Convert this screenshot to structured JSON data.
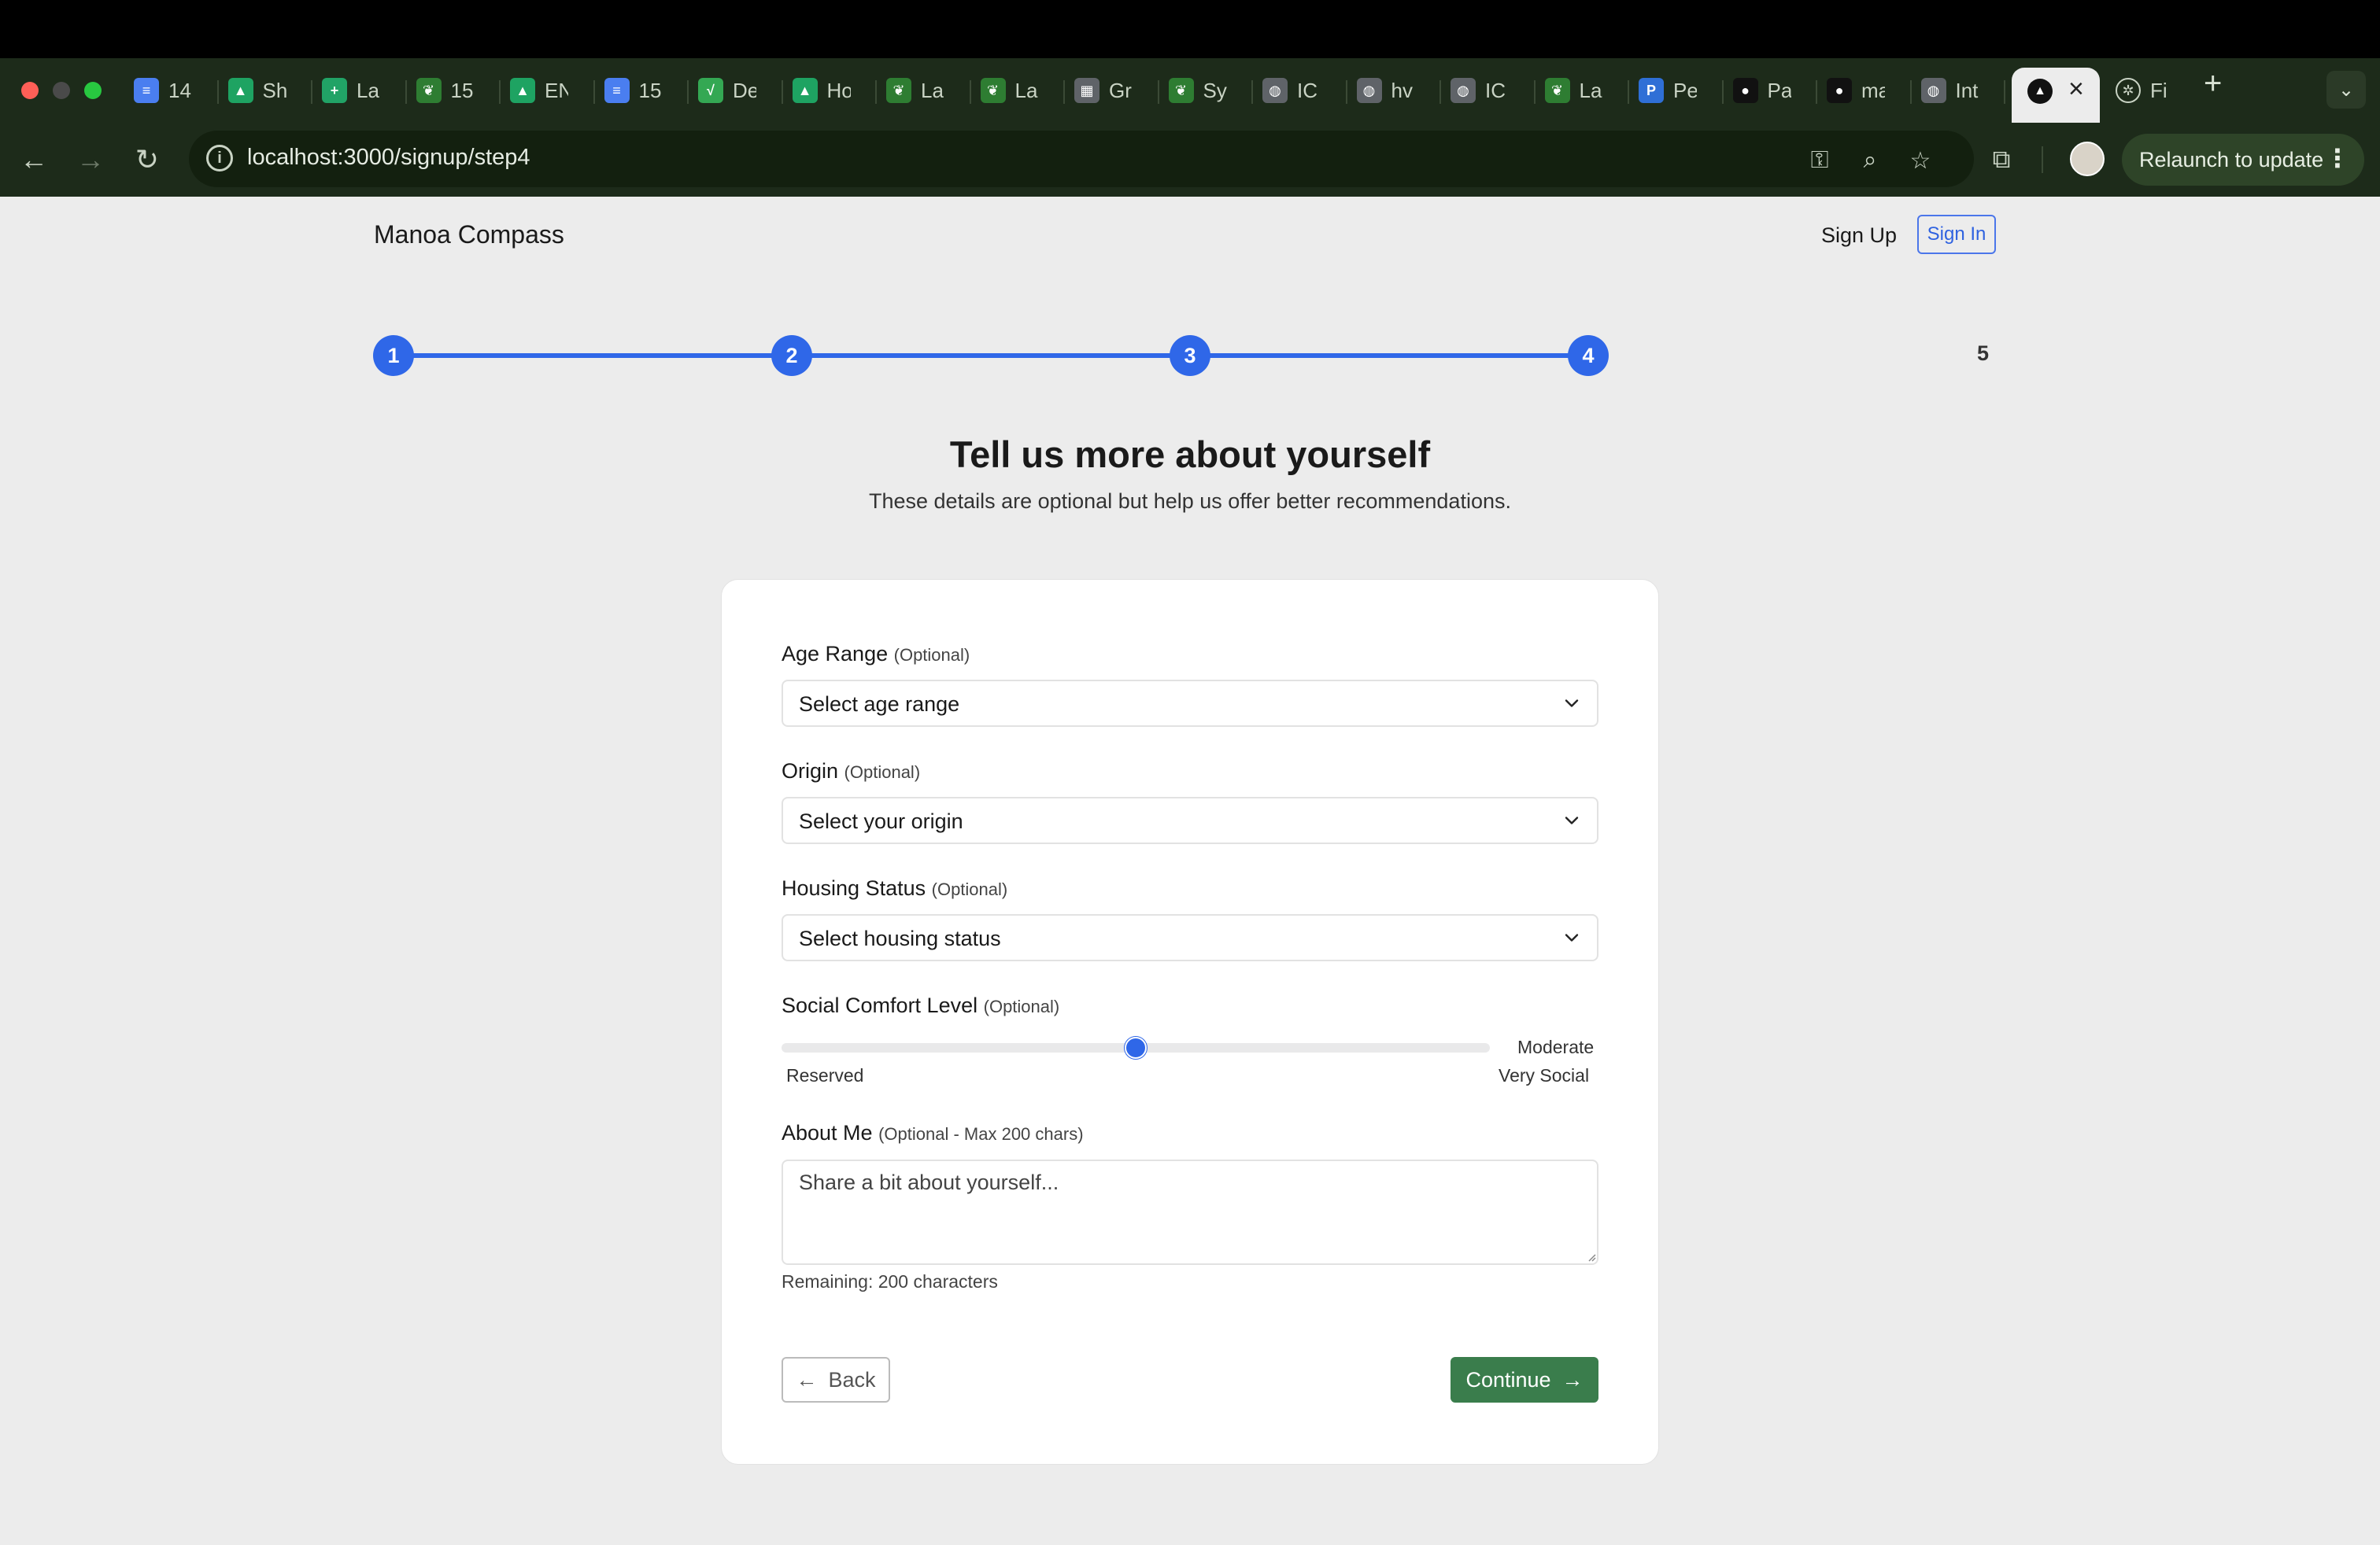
{
  "browser": {
    "tabs": [
      {
        "title": "14",
        "icon": "docs-icon",
        "color": "#4a7ef0",
        "glyph": "≡"
      },
      {
        "title": "Sh",
        "icon": "drive-icon",
        "color": "#1ea362",
        "glyph": "▲"
      },
      {
        "title": "La",
        "icon": "sheets-icon",
        "color": "#21a366",
        "glyph": "+"
      },
      {
        "title": "15",
        "icon": "leaf-icon",
        "color": "#2e7d32",
        "glyph": "❦"
      },
      {
        "title": "EN",
        "icon": "drive-icon",
        "color": "#1ea362",
        "glyph": "▲"
      },
      {
        "title": "15",
        "icon": "docs-icon",
        "color": "#4a7ef0",
        "glyph": "≡"
      },
      {
        "title": "De",
        "icon": "chart-icon",
        "color": "#34a853",
        "glyph": "√"
      },
      {
        "title": "Ho",
        "icon": "drive-icon",
        "color": "#1ea362",
        "glyph": "▲"
      },
      {
        "title": "La",
        "icon": "leaf-icon",
        "color": "#2e7d32",
        "glyph": "❦"
      },
      {
        "title": "La",
        "icon": "leaf-icon",
        "color": "#2e7d32",
        "glyph": "❦"
      },
      {
        "title": "Gr",
        "icon": "calculator-icon",
        "color": "#5f6368",
        "glyph": "▦"
      },
      {
        "title": "Sy",
        "icon": "leaf-icon",
        "color": "#2e7d32",
        "glyph": "❦"
      },
      {
        "title": "IC",
        "icon": "globe-icon",
        "color": "#5f6368",
        "glyph": "◍"
      },
      {
        "title": "hv",
        "icon": "globe-icon",
        "color": "#5f6368",
        "glyph": "◍"
      },
      {
        "title": "IC",
        "icon": "globe-icon",
        "color": "#5f6368",
        "glyph": "◍"
      },
      {
        "title": "La",
        "icon": "leaf-icon",
        "color": "#2e7d32",
        "glyph": "❦"
      },
      {
        "title": "Pe",
        "icon": "p-icon",
        "color": "#2f6fd6",
        "glyph": "P"
      },
      {
        "title": "Pa",
        "icon": "github-icon",
        "color": "#111111",
        "glyph": "●"
      },
      {
        "title": "ma",
        "icon": "github-icon",
        "color": "#111111",
        "glyph": "●"
      },
      {
        "title": "Int",
        "icon": "globe-icon",
        "color": "#5f6368",
        "glyph": "◍"
      }
    ],
    "active_tab_icon": "triangle-icon",
    "last_tab": {
      "title": "Fi",
      "icon": "openai-icon"
    },
    "url": "localhost:3000/signup/step4",
    "relaunch_label": "Relaunch to update"
  },
  "header": {
    "brand": "Manoa Compass",
    "signup_label": "Sign Up",
    "signin_label": "Sign In"
  },
  "progress": {
    "steps": [
      "1",
      "2",
      "3",
      "4",
      "5"
    ],
    "current_step": 4
  },
  "page": {
    "title": "Tell us more about yourself",
    "subtitle": "These details are optional but help us offer better recommendations."
  },
  "form": {
    "age_range": {
      "label": "Age Range",
      "optional": "(Optional)",
      "value": "Select age range"
    },
    "origin": {
      "label": "Origin",
      "optional": "(Optional)",
      "value": "Select your origin"
    },
    "housing": {
      "label": "Housing Status",
      "optional": "(Optional)",
      "value": "Select housing status"
    },
    "social": {
      "label": "Social Comfort Level",
      "optional": "(Optional)",
      "value_label": "Moderate",
      "min_label": "Reserved",
      "max_label": "Very Social",
      "level_fraction": 0.5
    },
    "about": {
      "label": "About Me",
      "optional": "(Optional - Max 200 chars)",
      "placeholder": "Share a bit about yourself...",
      "remaining": "Remaining: 200 characters"
    },
    "back_label": "Back",
    "continue_label": "Continue"
  },
  "colors": {
    "accent": "#2f67e8",
    "continue": "#3a7d4c"
  }
}
